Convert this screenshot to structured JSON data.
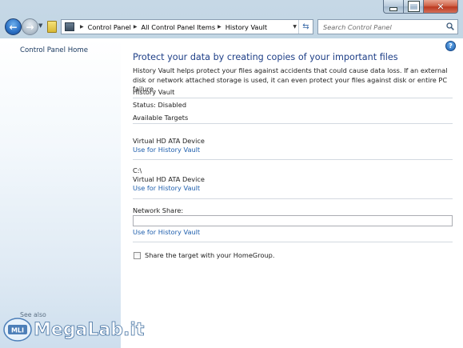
{
  "window": {
    "caption_buttons": {
      "minimize_icon": "minimize-icon",
      "maximize_icon": "maximize-icon",
      "close_icon": "close-icon"
    }
  },
  "toolbar": {
    "breadcrumbs": [
      "Control Panel",
      "All Control Panel Items",
      "History Vault"
    ],
    "search_placeholder": "Search Control Panel"
  },
  "sidebar": {
    "home_link": "Control Panel Home",
    "see_also": "See also"
  },
  "main": {
    "title": "Protect your data by creating copies of your important files",
    "description": "History Vault helps protect your files against accidents that could cause data loss. If an external disk or network attached storage is used, it can even protect your files against disk or entire PC failure.",
    "history_vault_label": "History Vault",
    "status_text": "Status: Disabled",
    "available_targets_label": "Available Targets",
    "targets": [
      {
        "drive": "",
        "device": "Virtual HD ATA Device",
        "link": "Use for History Vault"
      },
      {
        "drive": "C:\\",
        "device": "Virtual HD ATA Device",
        "link": "Use for History Vault"
      }
    ],
    "network_share_label": "Network Share:",
    "network_share_value": "",
    "network_link": "Use for History Vault",
    "share_homegroup_label": "Share the target with your HomeGroup.",
    "share_homegroup_checked": false
  },
  "watermark": {
    "brand": "MegaLab.it",
    "badge": "MLI"
  },
  "colors": {
    "title_blue": "#1e3f87",
    "link_blue": "#1f5fad",
    "chrome": "#b9cfe0"
  }
}
